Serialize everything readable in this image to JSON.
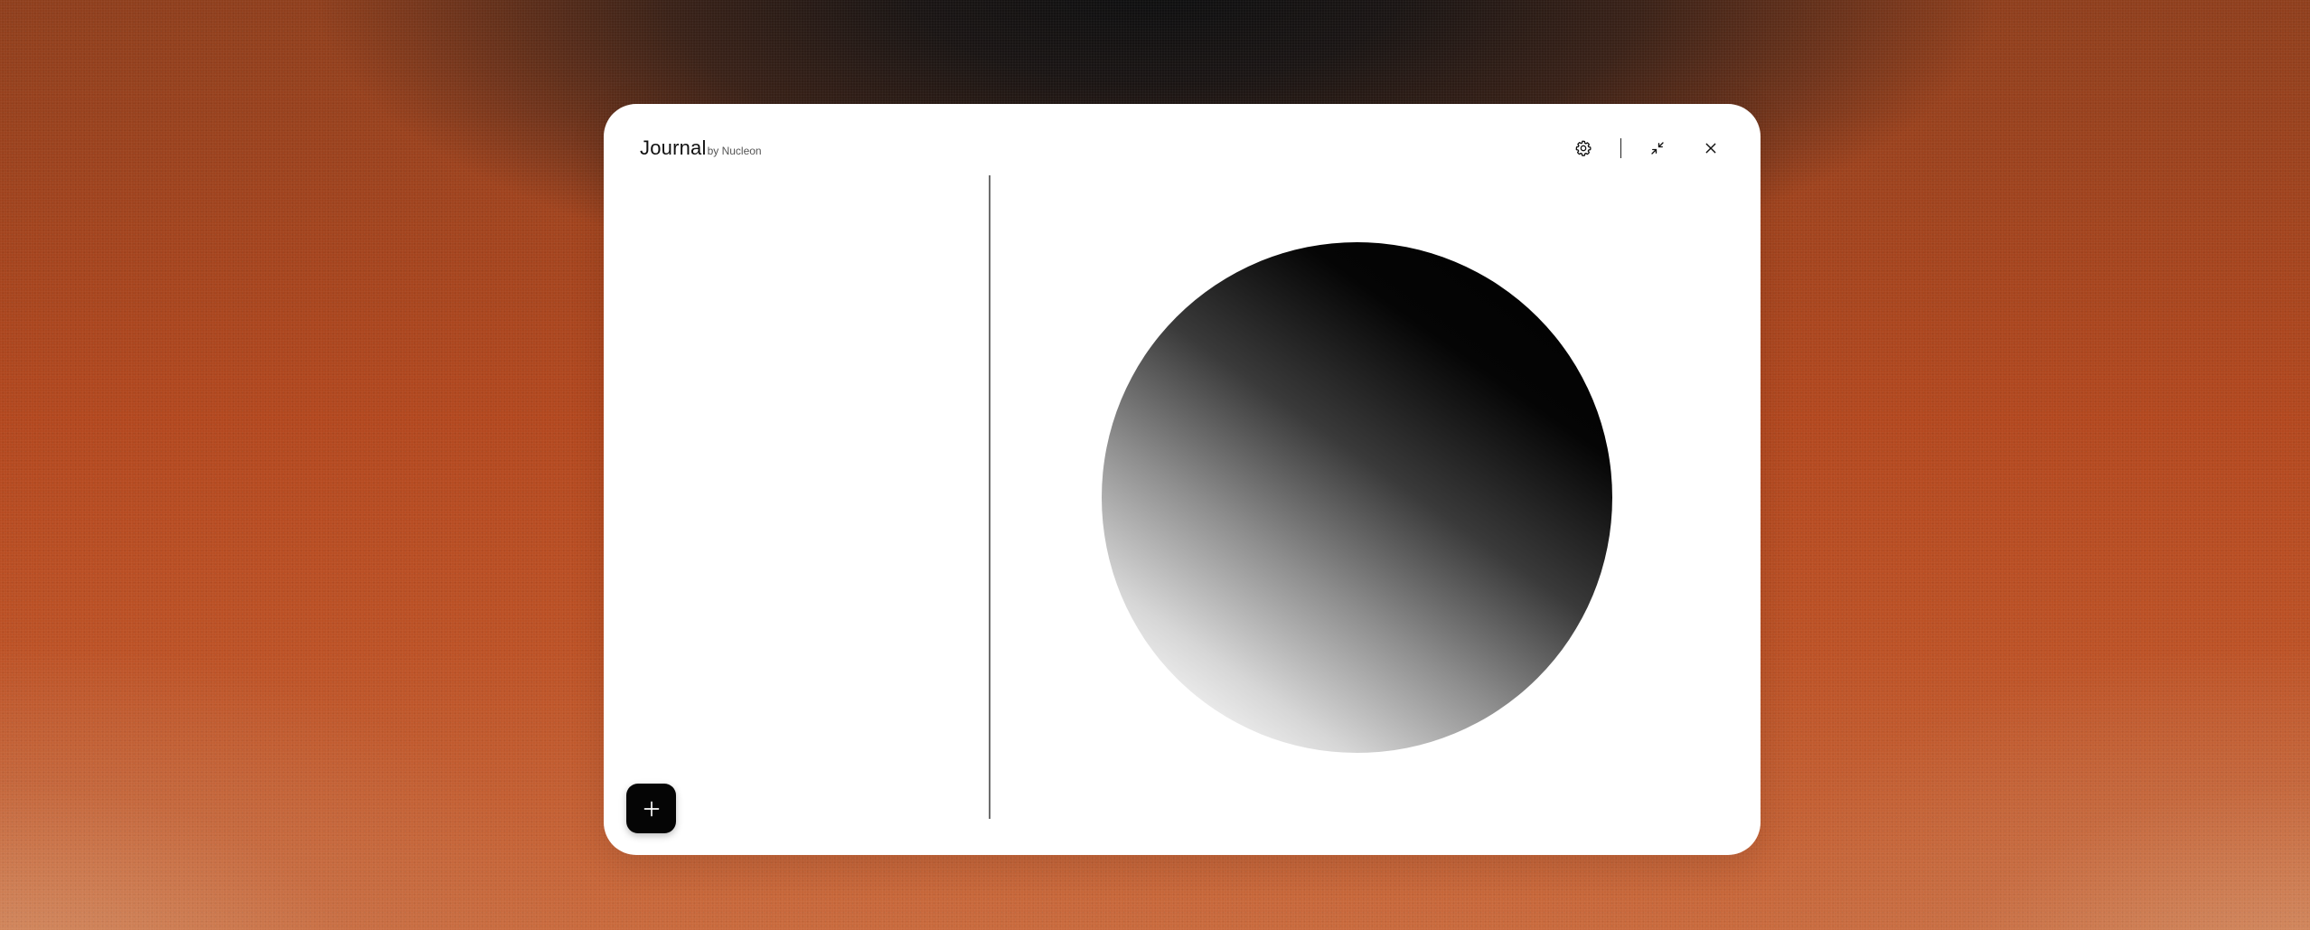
{
  "app": {
    "name": "Journal",
    "byline": "by Nucleon"
  },
  "toolbar": {
    "settings_icon": "gear-icon",
    "minimize_icon": "collapse-icon",
    "close_icon": "close-icon"
  },
  "sidebar": {
    "add_icon": "plus-icon"
  },
  "colors": {
    "accent": "#000000",
    "background": "#b3481f",
    "window": "#ffffff"
  }
}
